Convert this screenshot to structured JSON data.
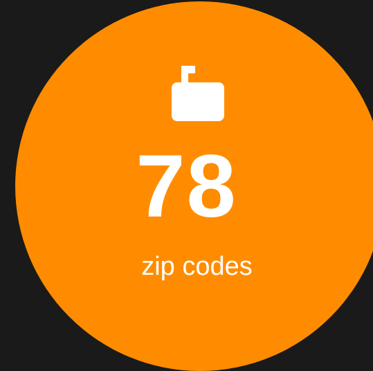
{
  "stat": {
    "icon": "mailbox-icon",
    "value": "78",
    "label": "zip codes"
  },
  "colors": {
    "background": "#1a1a1a",
    "accent": "#ff8c00",
    "text": "#ffffff"
  }
}
